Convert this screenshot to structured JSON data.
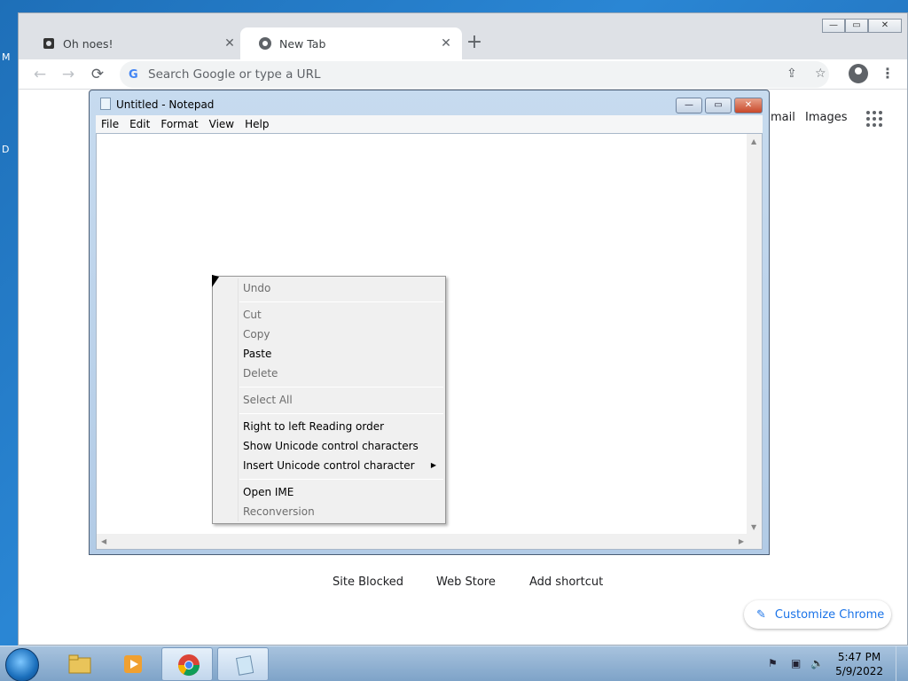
{
  "desktop": {
    "frag_left_1": "M",
    "frag_left_2": "D"
  },
  "chrome": {
    "tabs": [
      {
        "title": "Oh noes!",
        "close": "✕"
      },
      {
        "title": "New Tab",
        "close": "✕"
      }
    ],
    "new_tab": "+",
    "nav": {
      "back": "←",
      "forward": "→",
      "reload": "⟳"
    },
    "omnibox": {
      "g": "G",
      "placeholder": "Search Google or type a URL"
    },
    "share_icon": "⇪",
    "star_icon": "☆",
    "menu": "⋮",
    "win": {
      "min": "—",
      "max": "▭",
      "close": "✕"
    },
    "ntp": {
      "gmail": "mail",
      "images": "Images",
      "shortcuts": [
        "Site Blocked",
        "Web Store",
        "Add shortcut"
      ],
      "customize": "Customize Chrome",
      "customize_icon": "✎"
    }
  },
  "notepad": {
    "title": "Untitled - Notepad",
    "controls": {
      "min": "—",
      "max": "▭",
      "close": "✕"
    },
    "menu": [
      "File",
      "Edit",
      "Format",
      "View",
      "Help"
    ]
  },
  "context_menu": {
    "items": [
      {
        "label": "Undo",
        "enabled": false
      },
      {
        "label": "Cut",
        "enabled": false
      },
      {
        "label": "Copy",
        "enabled": false
      },
      {
        "label": "Paste",
        "enabled": true
      },
      {
        "label": "Delete",
        "enabled": false
      },
      {
        "label": "Select All",
        "enabled": false
      },
      {
        "label": "Right to left Reading order",
        "enabled": true
      },
      {
        "label": "Show Unicode control characters",
        "enabled": true
      },
      {
        "label": "Insert Unicode control character",
        "enabled": true
      },
      {
        "label": "Open IME",
        "enabled": true
      },
      {
        "label": "Reconversion",
        "enabled": false
      }
    ],
    "submenu_arrow": "▶"
  },
  "taskbar": {
    "time": "5:47 PM",
    "date": "5/9/2022",
    "tray": {
      "flag": "⚑",
      "network": "▣",
      "volume": "🔈"
    }
  }
}
